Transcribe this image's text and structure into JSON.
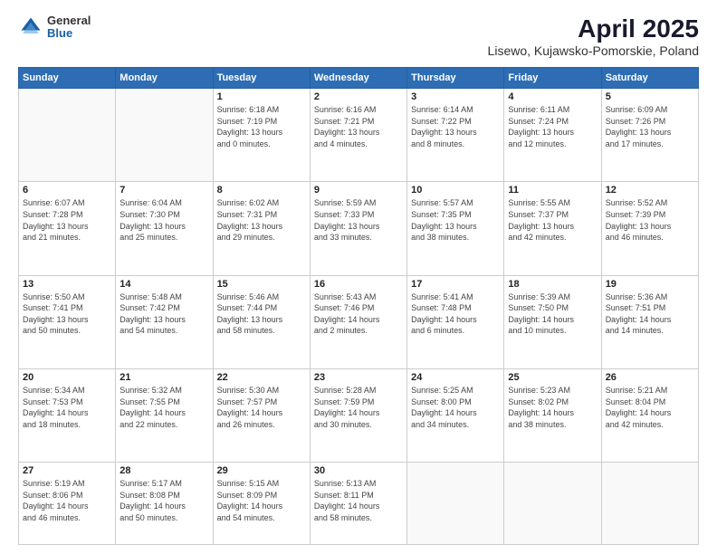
{
  "header": {
    "logo_general": "General",
    "logo_blue": "Blue",
    "title": "April 2025",
    "location": "Lisewo, Kujawsko-Pomorskie, Poland"
  },
  "weekdays": [
    "Sunday",
    "Monday",
    "Tuesday",
    "Wednesday",
    "Thursday",
    "Friday",
    "Saturday"
  ],
  "weeks": [
    [
      {
        "day": "",
        "info": ""
      },
      {
        "day": "",
        "info": ""
      },
      {
        "day": "1",
        "info": "Sunrise: 6:18 AM\nSunset: 7:19 PM\nDaylight: 13 hours\nand 0 minutes."
      },
      {
        "day": "2",
        "info": "Sunrise: 6:16 AM\nSunset: 7:21 PM\nDaylight: 13 hours\nand 4 minutes."
      },
      {
        "day": "3",
        "info": "Sunrise: 6:14 AM\nSunset: 7:22 PM\nDaylight: 13 hours\nand 8 minutes."
      },
      {
        "day": "4",
        "info": "Sunrise: 6:11 AM\nSunset: 7:24 PM\nDaylight: 13 hours\nand 12 minutes."
      },
      {
        "day": "5",
        "info": "Sunrise: 6:09 AM\nSunset: 7:26 PM\nDaylight: 13 hours\nand 17 minutes."
      }
    ],
    [
      {
        "day": "6",
        "info": "Sunrise: 6:07 AM\nSunset: 7:28 PM\nDaylight: 13 hours\nand 21 minutes."
      },
      {
        "day": "7",
        "info": "Sunrise: 6:04 AM\nSunset: 7:30 PM\nDaylight: 13 hours\nand 25 minutes."
      },
      {
        "day": "8",
        "info": "Sunrise: 6:02 AM\nSunset: 7:31 PM\nDaylight: 13 hours\nand 29 minutes."
      },
      {
        "day": "9",
        "info": "Sunrise: 5:59 AM\nSunset: 7:33 PM\nDaylight: 13 hours\nand 33 minutes."
      },
      {
        "day": "10",
        "info": "Sunrise: 5:57 AM\nSunset: 7:35 PM\nDaylight: 13 hours\nand 38 minutes."
      },
      {
        "day": "11",
        "info": "Sunrise: 5:55 AM\nSunset: 7:37 PM\nDaylight: 13 hours\nand 42 minutes."
      },
      {
        "day": "12",
        "info": "Sunrise: 5:52 AM\nSunset: 7:39 PM\nDaylight: 13 hours\nand 46 minutes."
      }
    ],
    [
      {
        "day": "13",
        "info": "Sunrise: 5:50 AM\nSunset: 7:41 PM\nDaylight: 13 hours\nand 50 minutes."
      },
      {
        "day": "14",
        "info": "Sunrise: 5:48 AM\nSunset: 7:42 PM\nDaylight: 13 hours\nand 54 minutes."
      },
      {
        "day": "15",
        "info": "Sunrise: 5:46 AM\nSunset: 7:44 PM\nDaylight: 13 hours\nand 58 minutes."
      },
      {
        "day": "16",
        "info": "Sunrise: 5:43 AM\nSunset: 7:46 PM\nDaylight: 14 hours\nand 2 minutes."
      },
      {
        "day": "17",
        "info": "Sunrise: 5:41 AM\nSunset: 7:48 PM\nDaylight: 14 hours\nand 6 minutes."
      },
      {
        "day": "18",
        "info": "Sunrise: 5:39 AM\nSunset: 7:50 PM\nDaylight: 14 hours\nand 10 minutes."
      },
      {
        "day": "19",
        "info": "Sunrise: 5:36 AM\nSunset: 7:51 PM\nDaylight: 14 hours\nand 14 minutes."
      }
    ],
    [
      {
        "day": "20",
        "info": "Sunrise: 5:34 AM\nSunset: 7:53 PM\nDaylight: 14 hours\nand 18 minutes."
      },
      {
        "day": "21",
        "info": "Sunrise: 5:32 AM\nSunset: 7:55 PM\nDaylight: 14 hours\nand 22 minutes."
      },
      {
        "day": "22",
        "info": "Sunrise: 5:30 AM\nSunset: 7:57 PM\nDaylight: 14 hours\nand 26 minutes."
      },
      {
        "day": "23",
        "info": "Sunrise: 5:28 AM\nSunset: 7:59 PM\nDaylight: 14 hours\nand 30 minutes."
      },
      {
        "day": "24",
        "info": "Sunrise: 5:25 AM\nSunset: 8:00 PM\nDaylight: 14 hours\nand 34 minutes."
      },
      {
        "day": "25",
        "info": "Sunrise: 5:23 AM\nSunset: 8:02 PM\nDaylight: 14 hours\nand 38 minutes."
      },
      {
        "day": "26",
        "info": "Sunrise: 5:21 AM\nSunset: 8:04 PM\nDaylight: 14 hours\nand 42 minutes."
      }
    ],
    [
      {
        "day": "27",
        "info": "Sunrise: 5:19 AM\nSunset: 8:06 PM\nDaylight: 14 hours\nand 46 minutes."
      },
      {
        "day": "28",
        "info": "Sunrise: 5:17 AM\nSunset: 8:08 PM\nDaylight: 14 hours\nand 50 minutes."
      },
      {
        "day": "29",
        "info": "Sunrise: 5:15 AM\nSunset: 8:09 PM\nDaylight: 14 hours\nand 54 minutes."
      },
      {
        "day": "30",
        "info": "Sunrise: 5:13 AM\nSunset: 8:11 PM\nDaylight: 14 hours\nand 58 minutes."
      },
      {
        "day": "",
        "info": ""
      },
      {
        "day": "",
        "info": ""
      },
      {
        "day": "",
        "info": ""
      }
    ]
  ]
}
